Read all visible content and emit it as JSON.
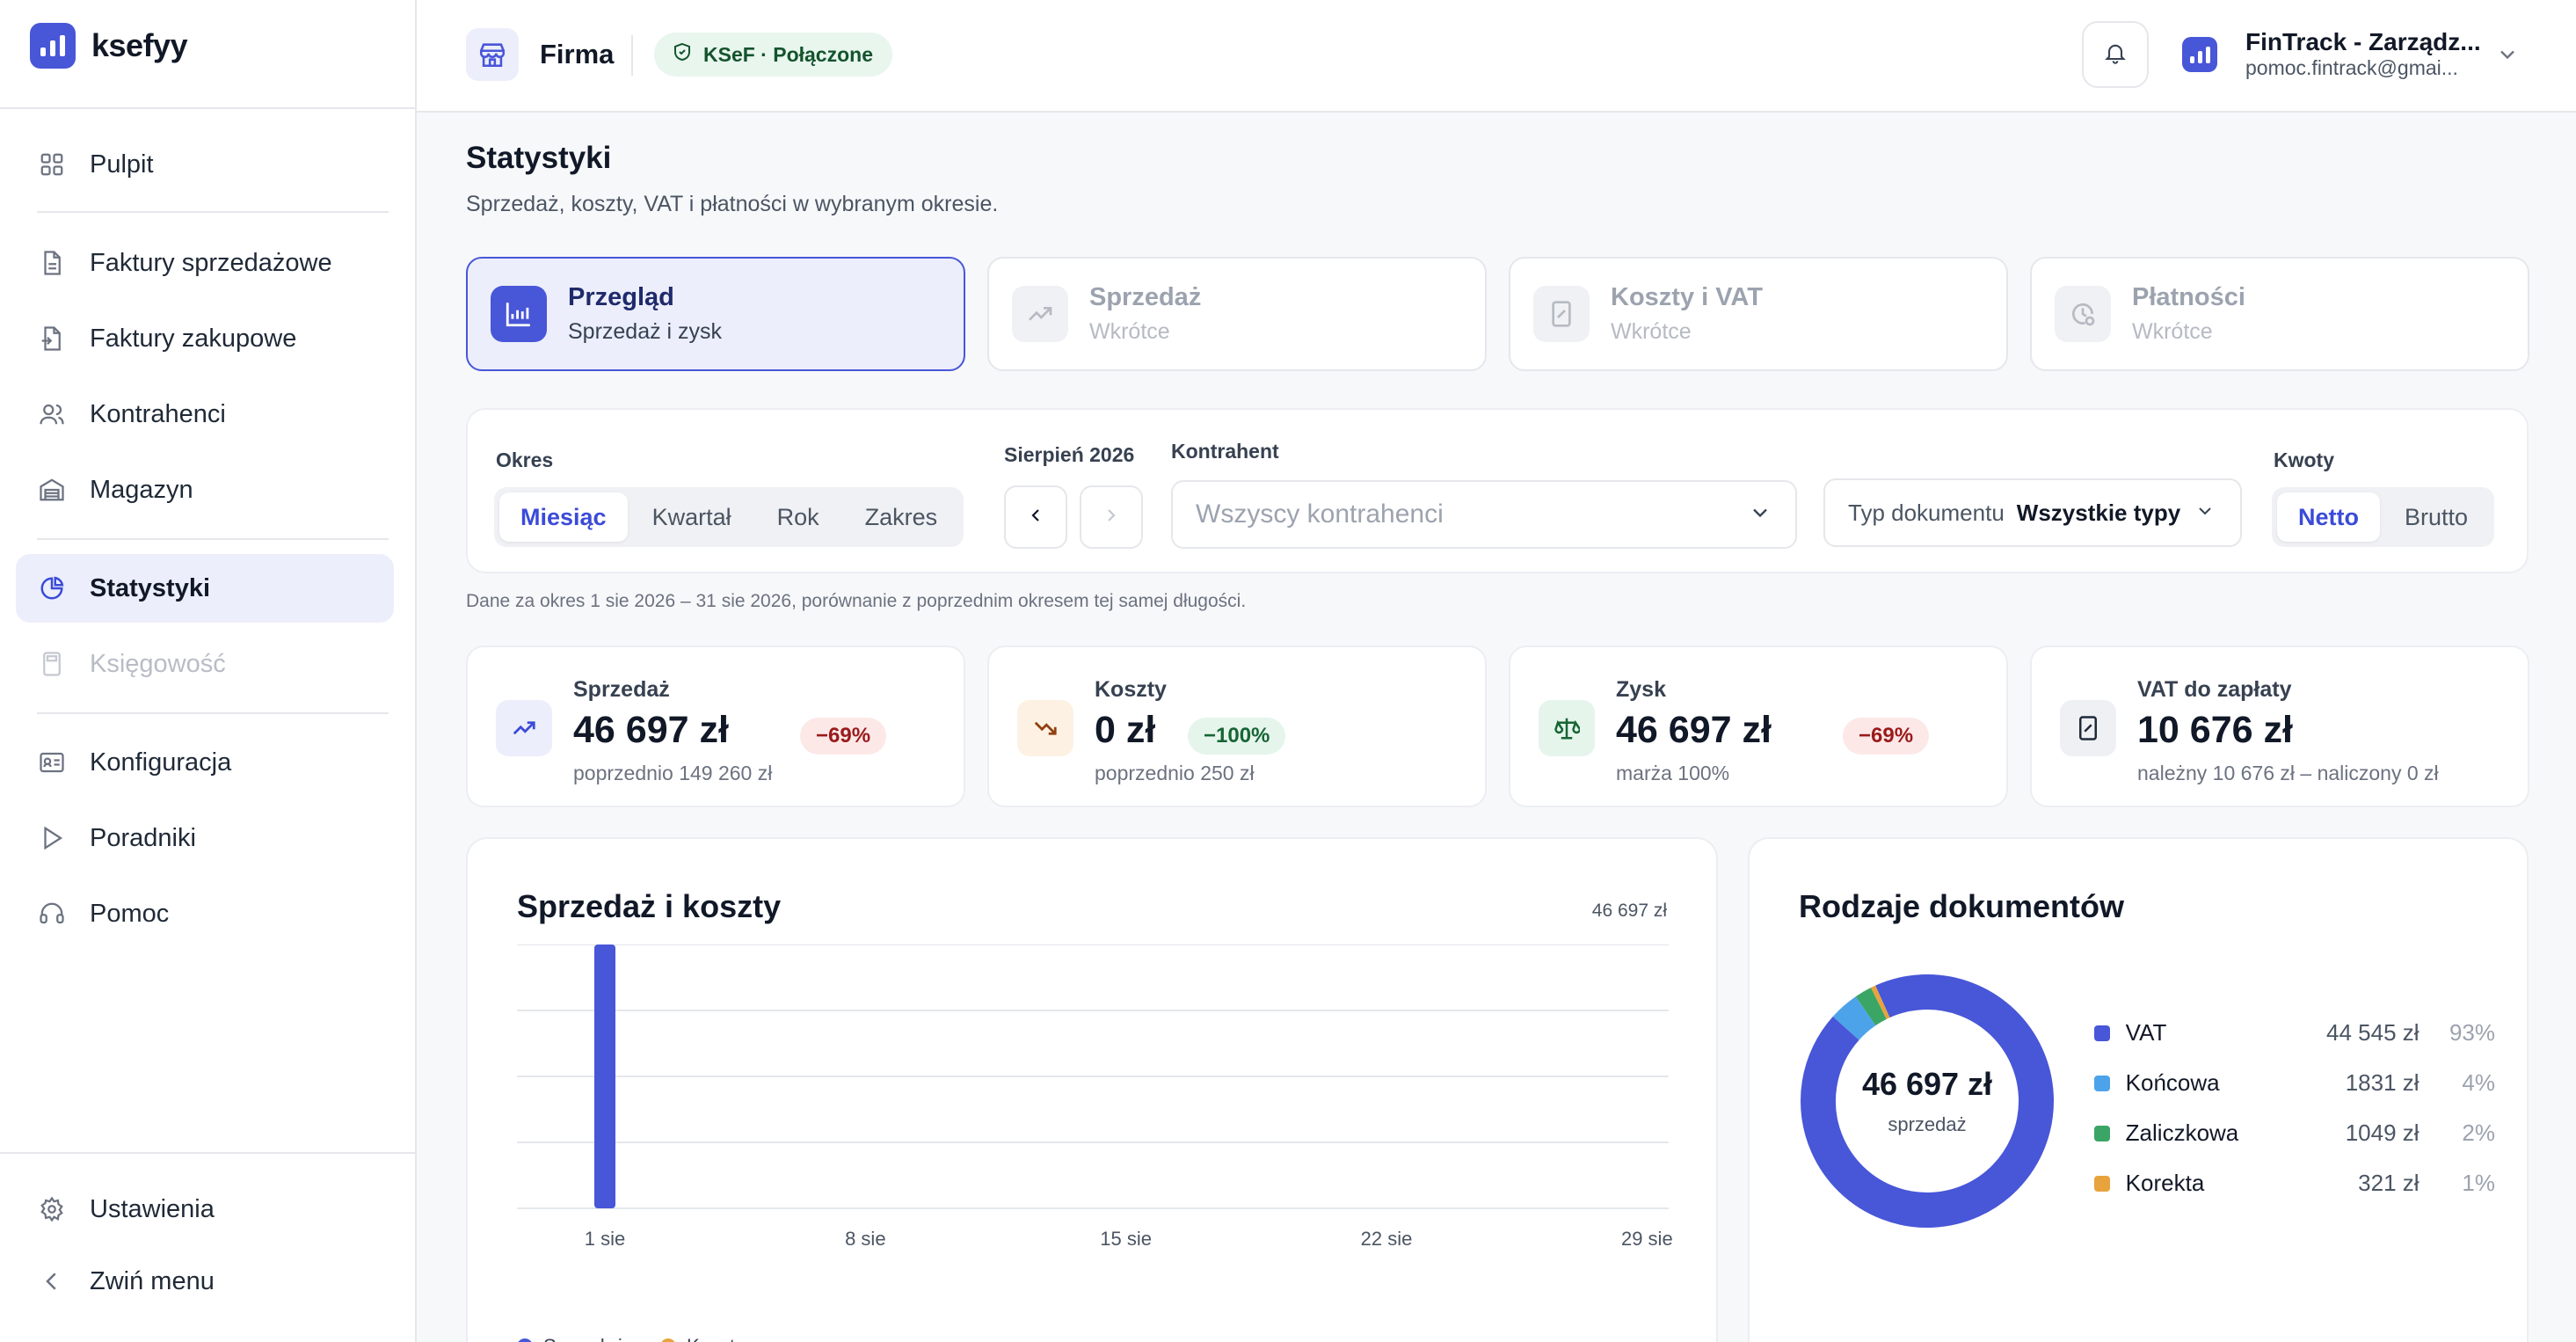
{
  "app": {
    "name": "ksefyy"
  },
  "sidebar": {
    "items": [
      {
        "label": "Pulpit",
        "icon": "grid-icon"
      },
      {
        "label": "Faktury sprzedażowe",
        "icon": "document-icon"
      },
      {
        "label": "Faktury zakupowe",
        "icon": "document-import-icon"
      },
      {
        "label": "Kontrahenci",
        "icon": "users-icon"
      },
      {
        "label": "Magazyn",
        "icon": "warehouse-icon"
      },
      {
        "label": "Statystyki",
        "icon": "pie-chart-icon",
        "active": true
      },
      {
        "label": "Księgowość",
        "icon": "calculator-icon",
        "disabled": true
      },
      {
        "label": "Konfiguracja",
        "icon": "id-card-icon"
      },
      {
        "label": "Poradniki",
        "icon": "play-icon"
      },
      {
        "label": "Pomoc",
        "icon": "headset-icon"
      }
    ],
    "bottom": {
      "settings": "Ustawienia",
      "collapse": "Zwiń menu"
    }
  },
  "header": {
    "firm_label": "Firma",
    "ksef_status": "KSeF · Połączone",
    "org_name": "FinTrack - Zarządz...",
    "org_email": "pomoc.fintrack@gmai..."
  },
  "page": {
    "title": "Statystyki",
    "subtitle": "Sprzedaż, koszty, VAT i płatności w wybranym okresie."
  },
  "tabs": [
    {
      "label": "Przegląd",
      "sub": "Sprzedaż i zysk",
      "icon": "chart-icon",
      "active": true
    },
    {
      "label": "Sprzedaż",
      "sub": "Wkrótce",
      "icon": "trend-up-icon"
    },
    {
      "label": "Koszty i VAT",
      "sub": "Wkrótce",
      "icon": "receipt-percent-icon"
    },
    {
      "label": "Płatności",
      "sub": "Wkrótce",
      "icon": "clock-money-icon"
    }
  ],
  "filters": {
    "period_label": "Okres",
    "period_options": [
      "Miesiąc",
      "Kwartał",
      "Rok",
      "Zakres"
    ],
    "period_selected": "Miesiąc",
    "month_label": "Sierpień 2026",
    "contractor_label": "Kontrahent",
    "contractor_placeholder": "Wszyscy kontrahenci",
    "doc_type_key": "Typ dokumentu",
    "doc_type_value": "Wszystkie typy",
    "amounts_label": "Kwoty",
    "amounts_options": [
      "Netto",
      "Brutto"
    ],
    "amounts_selected": "Netto"
  },
  "period_note": "Dane za okres 1 sie 2026 – 31 sie 2026, porównanie z poprzednim okresem tej samej długości.",
  "kpis": [
    {
      "label": "Sprzedaż",
      "value": "46 697 zł",
      "badge": "−69%",
      "badge_type": "bad",
      "sub": "poprzednio 149 260 zł",
      "icon": "trend-up-icon"
    },
    {
      "label": "Koszty",
      "value": "0 zł",
      "badge": "−100%",
      "badge_type": "good",
      "sub": "poprzednio 250 zł",
      "icon": "trend-down-icon"
    },
    {
      "label": "Zysk",
      "value": "46 697 zł",
      "badge": "−69%",
      "badge_type": "bad",
      "sub": "marża 100%",
      "icon": "scale-icon"
    },
    {
      "label": "VAT do zapłaty",
      "value": "10 676 zł",
      "sub": "należny 10 676 zł – naliczony 0 zł",
      "icon": "receipt-percent-icon"
    }
  ],
  "sales_chart": {
    "title": "Sprzedaż i koszty",
    "total": "46 697 zł",
    "legend": [
      "Sprzedaż",
      "Koszty"
    ]
  },
  "doc_types": {
    "title": "Rodzaje dokumentów",
    "center_value": "46 697 zł",
    "center_label": "sprzedaż",
    "rows": [
      {
        "name": "VAT",
        "value": "44 545 zł",
        "pct": "93%"
      },
      {
        "name": "Końcowa",
        "value": "1831 zł",
        "pct": "4%"
      },
      {
        "name": "Zaliczkowa",
        "value": "1049 zł",
        "pct": "2%"
      },
      {
        "name": "Korekta",
        "value": "321 zł",
        "pct": "1%"
      }
    ]
  },
  "colors": {
    "accent": "#4856d8",
    "sales": "#4856d8",
    "costs": "#e8a33d",
    "vat": "#4856d8",
    "koncowa": "#4da3ea",
    "zaliczkowa": "#3aa565",
    "korekta": "#e8a33d"
  },
  "chart_data": [
    {
      "type": "bar",
      "title": "Sprzedaż i koszty",
      "x_ticks": [
        "1 sie",
        "8 sie",
        "15 sie",
        "22 sie",
        "29 sie"
      ],
      "categories": [
        "1 sie",
        "2 sie",
        "3 sie",
        "4 sie",
        "5 sie",
        "6 sie",
        "7 sie",
        "8 sie",
        "9 sie",
        "10 sie",
        "11 sie",
        "12 sie",
        "13 sie",
        "14 sie",
        "15 sie",
        "16 sie",
        "17 sie",
        "18 sie",
        "19 sie",
        "20 sie",
        "21 sie",
        "22 sie",
        "23 sie",
        "24 sie",
        "25 sie",
        "26 sie",
        "27 sie",
        "28 sie",
        "29 sie",
        "30 sie",
        "31 sie"
      ],
      "series": [
        {
          "name": "Sprzedaż",
          "values": [
            46697,
            0,
            0,
            0,
            0,
            0,
            0,
            0,
            0,
            0,
            0,
            0,
            0,
            0,
            0,
            0,
            0,
            0,
            0,
            0,
            0,
            0,
            0,
            0,
            0,
            0,
            0,
            0,
            0,
            0,
            0
          ]
        },
        {
          "name": "Koszty",
          "values": [
            0,
            0,
            0,
            0,
            0,
            0,
            0,
            0,
            0,
            0,
            0,
            0,
            0,
            0,
            0,
            0,
            0,
            0,
            0,
            0,
            0,
            0,
            0,
            0,
            0,
            0,
            0,
            0,
            0,
            0,
            0
          ]
        }
      ],
      "ylim": [
        0,
        46697
      ],
      "grid": true,
      "legend": "bottom-left"
    },
    {
      "type": "pie",
      "title": "Rodzaje dokumentów",
      "labels": [
        "VAT",
        "Końcowa",
        "Zaliczkowa",
        "Korekta"
      ],
      "values": [
        44545,
        1831,
        1049,
        321
      ],
      "percent": [
        93,
        4,
        2,
        1
      ]
    }
  ]
}
